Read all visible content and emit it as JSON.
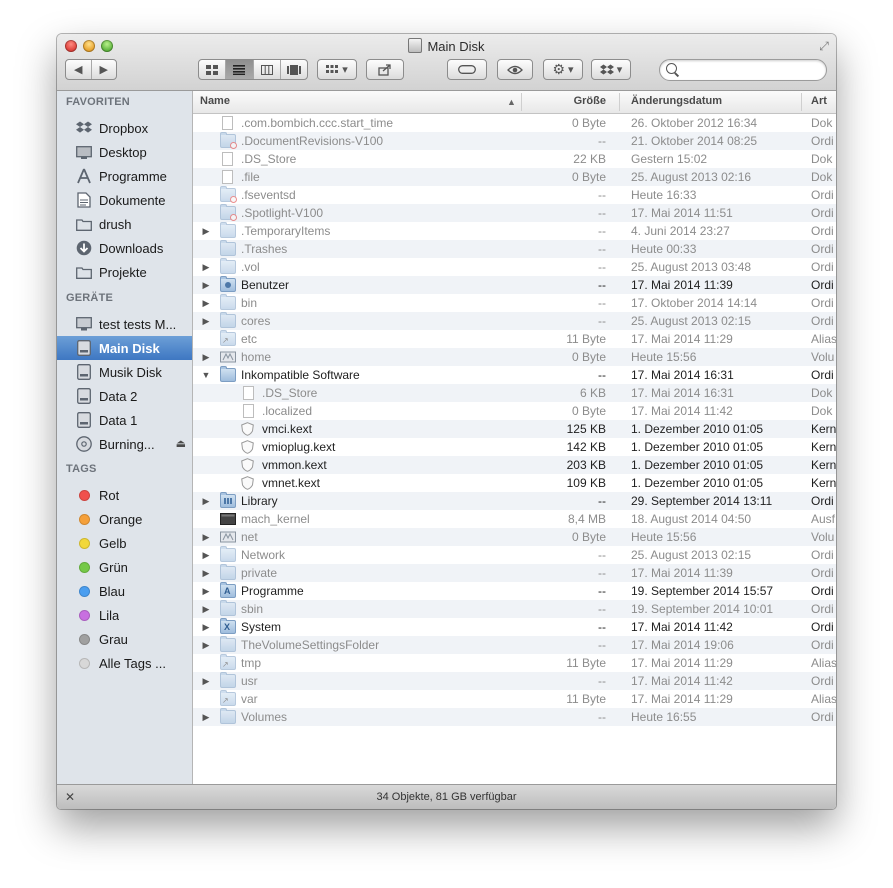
{
  "window": {
    "title": "Main Disk"
  },
  "toolbar": {
    "back_glyph": "◀",
    "forward_glyph": "▶",
    "action_glyph": "⚙",
    "dropdown_glyph": "▾",
    "share_glyph": "⇪",
    "search_placeholder": ""
  },
  "sidebar": {
    "favorites_heading": "FAVORITEN",
    "favorites": [
      {
        "label": "Dropbox",
        "icon": "dropbox-icon"
      },
      {
        "label": "Desktop",
        "icon": "desktop-icon"
      },
      {
        "label": "Programme",
        "icon": "applications-icon"
      },
      {
        "label": "Dokumente",
        "icon": "documents-icon"
      },
      {
        "label": "drush",
        "icon": "folder-icon"
      },
      {
        "label": "Downloads",
        "icon": "downloads-icon"
      },
      {
        "label": "Projekte",
        "icon": "folder-icon"
      }
    ],
    "devices_heading": "GERÄTE",
    "devices": [
      {
        "label": "test tests M...",
        "icon": "computer-icon"
      },
      {
        "label": "Main Disk",
        "icon": "disk-icon",
        "selected": true
      },
      {
        "label": "Musik Disk",
        "icon": "disk-icon"
      },
      {
        "label": "Data 2",
        "icon": "disk-icon"
      },
      {
        "label": "Data 1",
        "icon": "disk-icon"
      },
      {
        "label": "Burning...",
        "icon": "optical-disk-icon",
        "eject": "⏏"
      }
    ],
    "tags_heading": "TAGS",
    "tags": [
      {
        "label": "Rot",
        "color": "#f0504c"
      },
      {
        "label": "Orange",
        "color": "#f5a03a"
      },
      {
        "label": "Gelb",
        "color": "#f2d83a"
      },
      {
        "label": "Grün",
        "color": "#75c948"
      },
      {
        "label": "Blau",
        "color": "#4a9ef0"
      },
      {
        "label": "Lila",
        "color": "#c86fe0"
      },
      {
        "label": "Grau",
        "color": "#a0a0a0"
      },
      {
        "label": "Alle Tags ...",
        "color": "#d8d8d8"
      }
    ]
  },
  "columns": {
    "name": "Name",
    "size": "Größe",
    "date": "Änderungsdatum",
    "kind": "Art",
    "sort_glyph": "▲"
  },
  "files": [
    {
      "name": ".com.bombich.ccc.start_time",
      "size": "0 Byte",
      "date": "26. Oktober 2012 16:34",
      "kind": "Dok",
      "type": "doc",
      "dim": true,
      "depth": 0,
      "disc": ""
    },
    {
      "name": ".DocumentRevisions-V100",
      "size": "--",
      "date": "21. Oktober 2014 08:25",
      "kind": "Ordi",
      "type": "folder-restricted",
      "dim": true,
      "depth": 0,
      "disc": ""
    },
    {
      "name": ".DS_Store",
      "size": "22 KB",
      "date": "Gestern 15:02",
      "kind": "Dok",
      "type": "doc",
      "dim": true,
      "depth": 0,
      "disc": ""
    },
    {
      "name": ".file",
      "size": "0 Byte",
      "date": "25. August 2013 02:16",
      "kind": "Dok",
      "type": "doc",
      "dim": true,
      "depth": 0,
      "disc": ""
    },
    {
      "name": ".fseventsd",
      "size": "--",
      "date": "Heute 16:33",
      "kind": "Ordi",
      "type": "folder-restricted",
      "dim": true,
      "depth": 0,
      "disc": ""
    },
    {
      "name": ".Spotlight-V100",
      "size": "--",
      "date": "17. Mai 2014 11:51",
      "kind": "Ordi",
      "type": "folder-restricted",
      "dim": true,
      "depth": 0,
      "disc": ""
    },
    {
      "name": ".TemporaryItems",
      "size": "--",
      "date": "4. Juni 2014 23:27",
      "kind": "Ordi",
      "type": "folder",
      "dim": true,
      "depth": 0,
      "disc": "▶"
    },
    {
      "name": ".Trashes",
      "size": "--",
      "date": "Heute 00:33",
      "kind": "Ordi",
      "type": "folder",
      "dim": true,
      "depth": 0,
      "disc": ""
    },
    {
      "name": ".vol",
      "size": "--",
      "date": "25. August 2013 03:48",
      "kind": "Ordi",
      "type": "folder",
      "dim": true,
      "depth": 0,
      "disc": "▶"
    },
    {
      "name": "Benutzer",
      "size": "--",
      "date": "17. Mai 2014 11:39",
      "kind": "Ordi",
      "type": "folder-users",
      "dim": false,
      "depth": 0,
      "disc": "▶"
    },
    {
      "name": "bin",
      "size": "--",
      "date": "17. Oktober 2014 14:14",
      "kind": "Ordi",
      "type": "folder",
      "dim": true,
      "depth": 0,
      "disc": "▶"
    },
    {
      "name": "cores",
      "size": "--",
      "date": "25. August 2013 02:15",
      "kind": "Ordi",
      "type": "folder",
      "dim": true,
      "depth": 0,
      "disc": "▶"
    },
    {
      "name": "etc",
      "size": "11 Byte",
      "date": "17. Mai 2014 11:29",
      "kind": "Alias",
      "type": "folder-alias",
      "dim": true,
      "depth": 0,
      "disc": ""
    },
    {
      "name": "home",
      "size": "0 Byte",
      "date": "Heute 15:56",
      "kind": "Volu",
      "type": "volume",
      "dim": true,
      "depth": 0,
      "disc": "▶"
    },
    {
      "name": "Inkompatible Software",
      "size": "--",
      "date": "17. Mai 2014 16:31",
      "kind": "Ordi",
      "type": "folder",
      "dim": false,
      "depth": 0,
      "disc": "▼"
    },
    {
      "name": ".DS_Store",
      "size": "6 KB",
      "date": "17. Mai 2014 16:31",
      "kind": "Dok",
      "type": "doc",
      "dim": true,
      "depth": 1,
      "disc": ""
    },
    {
      "name": ".localized",
      "size": "0 Byte",
      "date": "17. Mai 2014 11:42",
      "kind": "Dok",
      "type": "doc",
      "dim": true,
      "depth": 1,
      "disc": ""
    },
    {
      "name": "vmci.kext",
      "size": "125 KB",
      "date": "1. Dezember 2010 01:05",
      "kind": "Kern",
      "type": "kext",
      "dim": false,
      "depth": 1,
      "disc": ""
    },
    {
      "name": "vmioplug.kext",
      "size": "142 KB",
      "date": "1. Dezember 2010 01:05",
      "kind": "Kern",
      "type": "kext",
      "dim": false,
      "depth": 1,
      "disc": ""
    },
    {
      "name": "vmmon.kext",
      "size": "203 KB",
      "date": "1. Dezember 2010 01:05",
      "kind": "Kern",
      "type": "kext",
      "dim": false,
      "depth": 1,
      "disc": ""
    },
    {
      "name": "vmnet.kext",
      "size": "109 KB",
      "date": "1. Dezember 2010 01:05",
      "kind": "Kern",
      "type": "kext",
      "dim": false,
      "depth": 1,
      "disc": ""
    },
    {
      "name": "Library",
      "size": "--",
      "date": "29. September 2014 13:11",
      "kind": "Ordi",
      "type": "folder-library",
      "dim": false,
      "depth": 0,
      "disc": "▶"
    },
    {
      "name": "mach_kernel",
      "size": "8,4 MB",
      "date": "18. August 2014 04:50",
      "kind": "Ausf",
      "type": "exec",
      "dim": true,
      "depth": 0,
      "disc": ""
    },
    {
      "name": "net",
      "size": "0 Byte",
      "date": "Heute 15:56",
      "kind": "Volu",
      "type": "volume",
      "dim": true,
      "depth": 0,
      "disc": "▶"
    },
    {
      "name": "Network",
      "size": "--",
      "date": "25. August 2013 02:15",
      "kind": "Ordi",
      "type": "folder",
      "dim": true,
      "depth": 0,
      "disc": "▶"
    },
    {
      "name": "private",
      "size": "--",
      "date": "17. Mai 2014 11:39",
      "kind": "Ordi",
      "type": "folder",
      "dim": true,
      "depth": 0,
      "disc": "▶"
    },
    {
      "name": "Programme",
      "size": "--",
      "date": "19. September 2014 15:57",
      "kind": "Ordi",
      "type": "folder-apps",
      "dim": false,
      "depth": 0,
      "disc": "▶"
    },
    {
      "name": "sbin",
      "size": "--",
      "date": "19. September 2014 10:01",
      "kind": "Ordi",
      "type": "folder",
      "dim": true,
      "depth": 0,
      "disc": "▶"
    },
    {
      "name": "System",
      "size": "--",
      "date": "17. Mai 2014 11:42",
      "kind": "Ordi",
      "type": "folder-system",
      "dim": false,
      "depth": 0,
      "disc": "▶"
    },
    {
      "name": "TheVolumeSettingsFolder",
      "size": "--",
      "date": "17. Mai 2014 19:06",
      "kind": "Ordi",
      "type": "folder",
      "dim": true,
      "depth": 0,
      "disc": "▶"
    },
    {
      "name": "tmp",
      "size": "11 Byte",
      "date": "17. Mai 2014 11:29",
      "kind": "Alias",
      "type": "folder-alias",
      "dim": true,
      "depth": 0,
      "disc": ""
    },
    {
      "name": "usr",
      "size": "--",
      "date": "17. Mai 2014 11:42",
      "kind": "Ordi",
      "type": "folder",
      "dim": true,
      "depth": 0,
      "disc": "▶"
    },
    {
      "name": "var",
      "size": "11 Byte",
      "date": "17. Mai 2014 11:29",
      "kind": "Alias",
      "type": "folder-alias",
      "dim": true,
      "depth": 0,
      "disc": ""
    },
    {
      "name": "Volumes",
      "size": "--",
      "date": "Heute 16:55",
      "kind": "Ordi",
      "type": "folder",
      "dim": true,
      "depth": 0,
      "disc": "▶"
    }
  ],
  "statusbar": {
    "text": "34 Objekte, 81 GB verfügbar"
  }
}
